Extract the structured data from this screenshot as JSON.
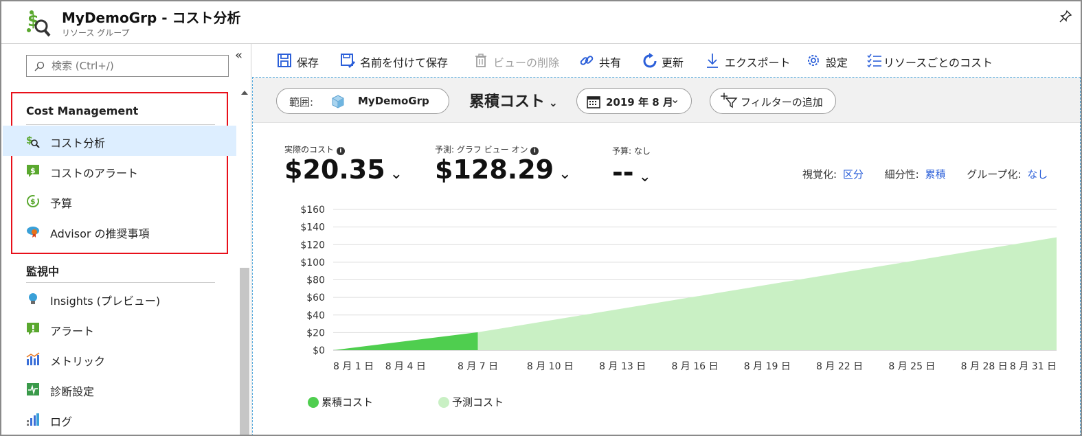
{
  "header": {
    "title": "MyDemoGrp  - コスト分析",
    "subtitle": "リソース グループ"
  },
  "sidebar": {
    "search_placeholder": "検索 (Ctrl+/)",
    "collapse_label": "«",
    "sections": [
      {
        "title": "Cost Management",
        "items": [
          {
            "label": "コスト分析",
            "icon": "cost-analysis-icon",
            "active": true
          },
          {
            "label": "コストのアラート",
            "icon": "cost-alert-icon"
          },
          {
            "label": "予算",
            "icon": "budget-icon"
          },
          {
            "label": "Advisor の推奨事項",
            "icon": "advisor-icon"
          }
        ]
      },
      {
        "title": "監視中",
        "items": [
          {
            "label": "Insights (プレビュー)",
            "icon": "insights-icon"
          },
          {
            "label": "アラート",
            "icon": "alert-icon"
          },
          {
            "label": "メトリック",
            "icon": "metrics-icon"
          },
          {
            "label": "診断設定",
            "icon": "diagnostic-settings-icon"
          },
          {
            "label": "ログ",
            "icon": "logs-icon"
          }
        ]
      }
    ]
  },
  "toolbar": {
    "save": "保存",
    "save_as": "名前を付けて保存",
    "delete_view": "ビューの削除",
    "share": "共有",
    "refresh": "更新",
    "export": "エクスポート",
    "settings": "設定",
    "cost_by_resource": "リソースごとのコスト"
  },
  "filters": {
    "scope_label": "範囲:",
    "scope_value": "MyDemoGrp",
    "view_name": "累積コスト",
    "date_range": "2019 年 8 月",
    "add_filter": "フィルターの追加"
  },
  "metrics": {
    "actual": {
      "label": "実際のコスト",
      "value": "$20.35"
    },
    "forecast": {
      "label": "予測: グラフ ビュー オン",
      "value": "$128.29"
    },
    "budget": {
      "label": "予算: なし",
      "value": "--"
    }
  },
  "chart_options": {
    "visualization_label": "視覚化:",
    "visualization_value": "区分",
    "granularity_label": "細分性:",
    "granularity_value": "累積",
    "group_label": "グループ化:",
    "group_value": "なし"
  },
  "colors": {
    "accent": "#2b5fd9",
    "actual_cost": "#4fce4f",
    "forecast_cost": "#c9f0c4",
    "highlight_box": "#e8101a"
  },
  "chart_data": {
    "type": "area",
    "x": [
      "8 月 1 日",
      "8 月 7 日",
      "8 月 31 日"
    ],
    "x_tick_labels": [
      "8 月 1 日",
      "8 月 4 日",
      "8 月 7 日",
      "8 月 10 日",
      "8 月 13 日",
      "8 月 16 日",
      "8 月 19 日",
      "8 月 22 日",
      "8 月 25 日",
      "8 月 28 日",
      "8 月 31 日"
    ],
    "series": [
      {
        "name": "累積コスト",
        "points": [
          [
            1,
            0
          ],
          [
            7,
            20.35
          ]
        ]
      },
      {
        "name": "予測コスト",
        "points": [
          [
            7,
            20.35
          ],
          [
            31,
            128.29
          ]
        ]
      }
    ],
    "ylim": [
      0,
      160
    ],
    "xlim": [
      1,
      31
    ],
    "y_tick_labels": [
      "$0",
      "$20",
      "$40",
      "$60",
      "$80",
      "$100",
      "$120",
      "$140",
      "$160"
    ],
    "y_ticks": [
      0,
      20,
      40,
      60,
      80,
      100,
      120,
      140,
      160
    ],
    "x_ticks": [
      1,
      4,
      7,
      10,
      13,
      16,
      19,
      22,
      25,
      28,
      31
    ],
    "grid": true,
    "legend": "bottom-left"
  }
}
